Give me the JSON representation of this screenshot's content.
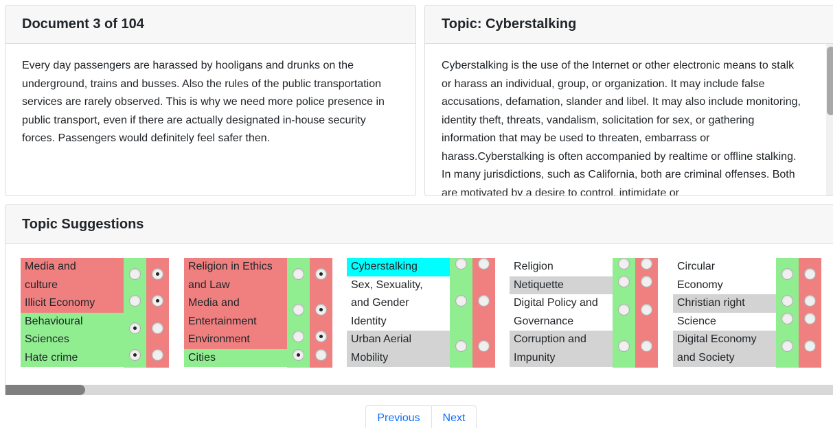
{
  "document_card": {
    "title": "Document 3 of 104",
    "text": "Every day passengers are harassed by hooligans and drunks on the underground, trains and busses. Also the rules of the public transportation services are rarely observed. This is why we need more police presence in public transport, even if there are actually designated in-house security forces. Passengers would definitely feel safer then."
  },
  "topic_card": {
    "title": "Topic: Cyberstalking",
    "text": "Cyberstalking is the use of the Internet or other electronic means to stalk or harass an individual, group, or organization. It may include false accusations, defamation, slander and libel. It may also include monitoring, identity theft, threats, vandalism, solicitation for sex, or gathering information that may be used to threaten, embarrass or harass.Cyberstalking is often accompanied by realtime or offline stalking. In many jurisdictions, such as California, both are criminal offenses. Both are motivated by a desire to control, intimidate or"
  },
  "suggestions": {
    "title": "Topic Suggestions",
    "groups": [
      {
        "items": [
          {
            "label": "Media and",
            "color": "red"
          },
          {
            "label": "culture",
            "color": "red"
          },
          {
            "label": "Illicit Economy",
            "color": "red"
          },
          {
            "label": "Behavioural",
            "color": "green"
          },
          {
            "label": "Sciences",
            "color": "green"
          },
          {
            "label": "Hate crime",
            "color": "green"
          }
        ]
      },
      {
        "items": [
          {
            "label": "Religion in Ethics",
            "color": "red"
          },
          {
            "label": "and Law",
            "color": "red"
          },
          {
            "label": "Media and",
            "color": "red"
          },
          {
            "label": "Entertainment",
            "color": "red"
          },
          {
            "label": "Environment",
            "color": "red"
          },
          {
            "label": "Cities",
            "color": "green"
          }
        ]
      },
      {
        "items": [
          {
            "label": "Cyberstalking",
            "color": "cyan"
          },
          {
            "label": "Sex, Sexuality,",
            "color": "white"
          },
          {
            "label": "and Gender",
            "color": "white"
          },
          {
            "label": "Identity",
            "color": "white"
          },
          {
            "label": "Urban Aerial",
            "color": "gray"
          },
          {
            "label": "Mobility",
            "color": "gray"
          }
        ]
      },
      {
        "items": [
          {
            "label": "Religion",
            "color": "white"
          },
          {
            "label": "Netiquette",
            "color": "gray"
          },
          {
            "label": "Digital Policy and",
            "color": "white"
          },
          {
            "label": "Governance",
            "color": "white"
          },
          {
            "label": "Corruption and",
            "color": "gray"
          },
          {
            "label": "Impunity",
            "color": "gray"
          }
        ]
      },
      {
        "items": [
          {
            "label": "Circular",
            "color": "white"
          },
          {
            "label": "Economy",
            "color": "white"
          },
          {
            "label": "Christian right",
            "color": "gray"
          },
          {
            "label": "Science",
            "color": "white"
          },
          {
            "label": "Digital Economy",
            "color": "gray"
          },
          {
            "label": "and Society",
            "color": "gray"
          }
        ]
      }
    ]
  },
  "pagination": {
    "previous_label": "Previous",
    "next_label": "Next"
  },
  "colors": {
    "red": "#f08080",
    "green": "#90ee90",
    "gray": "#d3d3d3",
    "cyan": "#00ffff",
    "link": "#0d6efd"
  }
}
